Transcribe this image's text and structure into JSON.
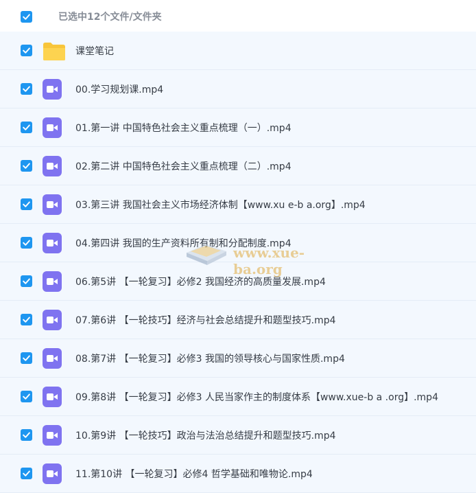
{
  "header": {
    "selection_text": "已选中12个文件/文件夹"
  },
  "colors": {
    "checkbox": "#1e96f0",
    "video_icon": "#7f73f0",
    "folder": "#f8c53a",
    "row_bg": "#f3f8fe"
  },
  "files": [
    {
      "name": "课堂笔记",
      "type": "folder-icon"
    },
    {
      "name": "00.学习规划课.mp4",
      "type": "video-icon"
    },
    {
      "name": "01.第一讲 中国特色社会主义重点梳理（一）.mp4",
      "type": "video-icon"
    },
    {
      "name": "02.第二讲 中国特色社会主义重点梳理（二）.mp4",
      "type": "video-icon"
    },
    {
      "name": "03.第三讲 我国社会主义市场经济体制【www.xu e-b a.org】.mp4",
      "type": "video-icon"
    },
    {
      "name": "04.第四讲 我国的生产资料所有制和分配制度.mp4",
      "type": "video-icon"
    },
    {
      "name": "06.第5讲 【一轮复习】必修2 我国经济的高质量发展.mp4",
      "type": "video-icon"
    },
    {
      "name": "07.第6讲 【一轮技巧】经济与社会总结提升和题型技巧.mp4",
      "type": "video-icon"
    },
    {
      "name": "08.第7讲 【一轮复习】必修3 我国的领导核心与国家性质.mp4",
      "type": "video-icon"
    },
    {
      "name": "09.第8讲 【一轮复习】必修3 人民当家作主的制度体系【www.xue-b a .org】.mp4",
      "type": "video-icon"
    },
    {
      "name": "10.第9讲 【一轮技巧】政治与法治总结提升和题型技巧.mp4",
      "type": "video-icon"
    },
    {
      "name": "11.第10讲 【一轮复习】必修4 哲学基础和唯物论.mp4",
      "type": "video-icon"
    }
  ],
  "watermark": {
    "text": "www.xue-ba.org",
    "icon": "book-stack-logo-icon"
  }
}
